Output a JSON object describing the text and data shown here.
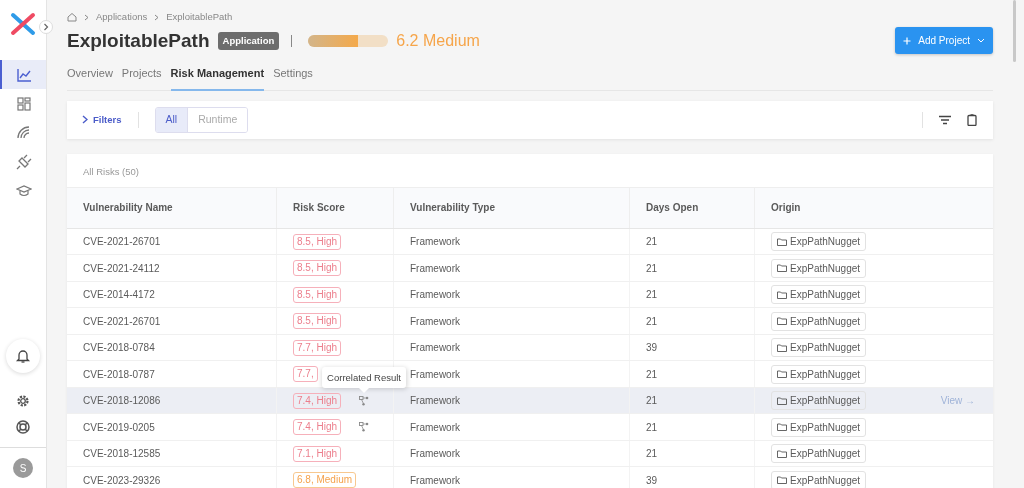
{
  "sidebar": {
    "nav_items": [
      {
        "selected": true
      },
      {
        "selected": false
      },
      {
        "selected": false
      },
      {
        "selected": false
      },
      {
        "selected": false
      }
    ],
    "avatar": "S"
  },
  "breadcrumb": [
    "Applications",
    "ExploitablePath"
  ],
  "title": "ExploitablePath",
  "badge": "Application",
  "risk": {
    "level": 0.62,
    "reading": "6.2 Medium"
  },
  "add_button": "Add Project",
  "tabs": [
    {
      "label": "Overview",
      "selected": false
    },
    {
      "label": "Projects",
      "selected": false
    },
    {
      "label": "Risk Management",
      "selected": true
    },
    {
      "label": "Settings",
      "selected": false
    }
  ],
  "filters": {
    "toggle": "Filters",
    "segments": [
      {
        "label": "All",
        "selected": true
      },
      {
        "label": "Runtime",
        "selected": false
      }
    ]
  },
  "table": {
    "caption": "All Risks (50)",
    "tooltip": "Correlated Result",
    "columns": [
      "Vulnerability Name",
      "Risk Score",
      "Vulnerability Type",
      "Days Open",
      "Origin"
    ],
    "rows": [
      {
        "name": "CVE-2021-26701",
        "score": "8.5, High",
        "kind": "high",
        "correlated": false,
        "type": "Framework",
        "days": "21",
        "origin": "ExpPathNugget",
        "hovered": false
      },
      {
        "name": "CVE-2021-24112",
        "score": "8.5, High",
        "kind": "high",
        "correlated": false,
        "type": "Framework",
        "days": "21",
        "origin": "ExpPathNugget",
        "hovered": false
      },
      {
        "name": "CVE-2014-4172",
        "score": "8.5, High",
        "kind": "high",
        "correlated": false,
        "type": "Framework",
        "days": "21",
        "origin": "ExpPathNugget",
        "hovered": false
      },
      {
        "name": "CVE-2021-26701",
        "score": "8.5, High",
        "kind": "high",
        "correlated": false,
        "type": "Framework",
        "days": "21",
        "origin": "ExpPathNugget",
        "hovered": false
      },
      {
        "name": "CVE-2018-0784",
        "score": "7.7, High",
        "kind": "high",
        "correlated": false,
        "type": "Framework",
        "days": "39",
        "origin": "ExpPathNugget",
        "hovered": false
      },
      {
        "name": "CVE-2018-0787",
        "score": "7.7,",
        "kind": "high",
        "correlated": false,
        "type": "Framework",
        "days": "21",
        "origin": "ExpPathNugget",
        "hovered": false
      },
      {
        "name": "CVE-2018-12086",
        "score": "7.4, High",
        "kind": "high",
        "correlated": true,
        "type": "Framework",
        "days": "21",
        "origin": "ExpPathNugget",
        "hovered": true,
        "action": "View →"
      },
      {
        "name": "CVE-2019-0205",
        "score": "7.4, High",
        "kind": "high",
        "correlated": true,
        "type": "Framework",
        "days": "21",
        "origin": "ExpPathNugget",
        "hovered": false
      },
      {
        "name": "CVE-2018-12585",
        "score": "7.1, High",
        "kind": "high",
        "correlated": false,
        "type": "Framework",
        "days": "21",
        "origin": "ExpPathNugget",
        "hovered": false
      },
      {
        "name": "CVE-2023-29326",
        "score": "6.8, Medium",
        "kind": "medium",
        "correlated": false,
        "type": "Framework",
        "days": "39",
        "origin": "ExpPathNugget",
        "hovered": false
      }
    ]
  }
}
